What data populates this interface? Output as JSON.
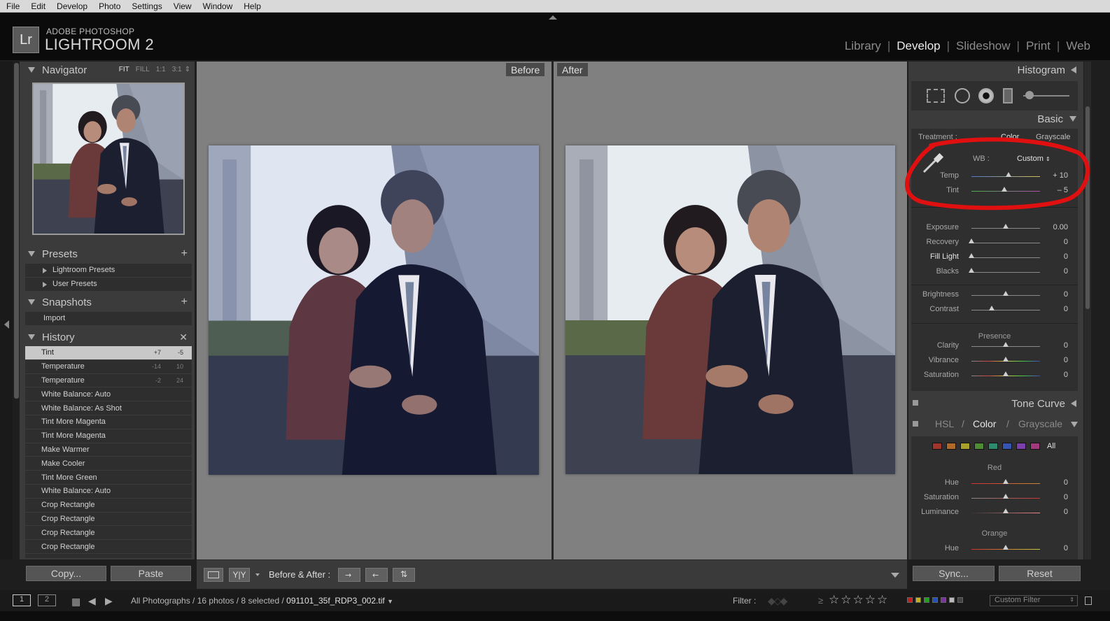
{
  "menu": [
    "File",
    "Edit",
    "Develop",
    "Photo",
    "Settings",
    "View",
    "Window",
    "Help"
  ],
  "app": {
    "logo": "Lr",
    "brand_top": "ADOBE PHOTOSHOP",
    "brand_main": "LIGHTROOM 2"
  },
  "modules": [
    "Library",
    "Develop",
    "Slideshow",
    "Print",
    "Web"
  ],
  "active_module": "Develop",
  "navigator": {
    "title": "Navigator",
    "options": [
      "FIT",
      "FILL",
      "1:1",
      "3:1"
    ]
  },
  "presets": {
    "title": "Presets",
    "items": [
      "Lightroom Presets",
      "User Presets"
    ]
  },
  "snapshots": {
    "title": "Snapshots",
    "items": [
      "Import"
    ]
  },
  "history": {
    "title": "History",
    "items": [
      {
        "label": "Tint",
        "a": "+7",
        "b": "-5"
      },
      {
        "label": "Temperature",
        "a": "-14",
        "b": "10"
      },
      {
        "label": "Temperature",
        "a": "-2",
        "b": "24"
      },
      {
        "label": "White Balance: Auto",
        "a": "",
        "b": ""
      },
      {
        "label": "White Balance: As Shot",
        "a": "",
        "b": ""
      },
      {
        "label": "Tint More Magenta",
        "a": "",
        "b": ""
      },
      {
        "label": "Tint More Magenta",
        "a": "",
        "b": ""
      },
      {
        "label": "Make Warmer",
        "a": "",
        "b": ""
      },
      {
        "label": "Make Cooler",
        "a": "",
        "b": ""
      },
      {
        "label": "Tint More Green",
        "a": "",
        "b": ""
      },
      {
        "label": "White Balance: Auto",
        "a": "",
        "b": ""
      },
      {
        "label": "Crop Rectangle",
        "a": "",
        "b": ""
      },
      {
        "label": "Crop Rectangle",
        "a": "",
        "b": ""
      },
      {
        "label": "Crop Rectangle",
        "a": "",
        "b": ""
      },
      {
        "label": "Crop Rectangle",
        "a": "",
        "b": ""
      }
    ]
  },
  "left_buttons": {
    "copy": "Copy...",
    "paste": "Paste"
  },
  "view": {
    "before": "Before",
    "after": "After"
  },
  "toolbar": {
    "yy": "Y|Y",
    "before_after": "Before & After :"
  },
  "right": {
    "histogram": "Histogram",
    "basic": "Basic",
    "treatment_label": "Treatment :",
    "treatment_color": "Color",
    "treatment_gray": "Grayscale",
    "wb_label": "WB :",
    "wb_value": "Custom",
    "wb_sliders": [
      {
        "name": "Temp",
        "value": "+ 10",
        "pos": 0.54
      },
      {
        "name": "Tint",
        "value": "– 5",
        "pos": 0.48
      }
    ],
    "tone_sliders": [
      {
        "name": "Exposure",
        "value": "0.00",
        "pos": 0.5
      },
      {
        "name": "Recovery",
        "value": "0",
        "pos": 0.0
      },
      {
        "name": "Fill Light",
        "value": "0",
        "pos": 0.0
      },
      {
        "name": "Blacks",
        "value": "0",
        "pos": 0.0
      }
    ],
    "bc_sliders": [
      {
        "name": "Brightness",
        "value": "0",
        "pos": 0.5
      },
      {
        "name": "Contrast",
        "value": "0",
        "pos": 0.3
      }
    ],
    "presence_title": "Presence",
    "presence_sliders": [
      {
        "name": "Clarity",
        "value": "0",
        "pos": 0.5
      },
      {
        "name": "Vibrance",
        "value": "0",
        "pos": 0.5
      },
      {
        "name": "Saturation",
        "value": "0",
        "pos": 0.5
      }
    ],
    "tone_curve": "Tone Curve",
    "hsl": "HSL",
    "color": "Color",
    "grayscale": "Grayscale",
    "all": "All",
    "swatches": [
      "#a0352b",
      "#b06a25",
      "#a8a027",
      "#4d8c33",
      "#2c8a6e",
      "#3655b0",
      "#7a3fa8",
      "#a03a7a"
    ],
    "red_title": "Red",
    "red_sliders": [
      {
        "name": "Hue",
        "value": "0",
        "pos": 0.5
      },
      {
        "name": "Saturation",
        "value": "0",
        "pos": 0.5
      },
      {
        "name": "Luminance",
        "value": "0",
        "pos": 0.5
      }
    ],
    "orange_title": "Orange",
    "orange_sliders": [
      {
        "name": "Hue",
        "value": "0",
        "pos": 0.5
      }
    ],
    "sync": "Sync...",
    "reset": "Reset"
  },
  "filmstrip": {
    "screen1": "1",
    "screen2": "2",
    "path": "All Photographs / 16 photos / 8 selected /",
    "filename": "091101_35f_RDP3_002.tif",
    "filter_label": "Filter :",
    "custom_filter": "Custom Filter"
  },
  "colors": {
    "annotation": "#e01010",
    "panel": "#3b3b3b",
    "canvas": "#808080"
  }
}
